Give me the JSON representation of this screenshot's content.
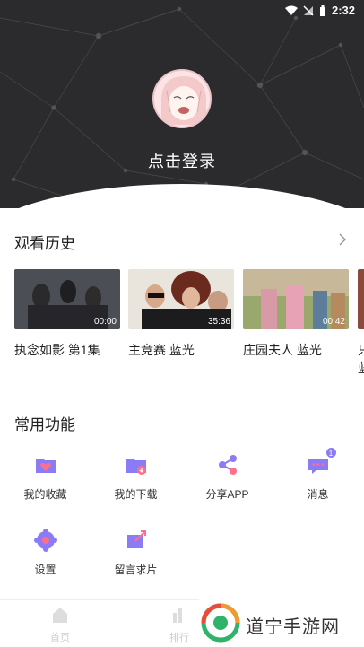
{
  "status_bar": {
    "time": "2:32"
  },
  "header": {
    "login_text": "点击登录"
  },
  "history": {
    "title": "观看历史",
    "items": [
      {
        "title": "执念如影 第1集",
        "duration": "00:00"
      },
      {
        "title": "主竞赛 蓝光",
        "duration": "35:36"
      },
      {
        "title": "庄园夫人 蓝光",
        "duration": "00:42"
      },
      {
        "title": "只 蓝",
        "duration": ""
      }
    ]
  },
  "functions": {
    "title": "常用功能",
    "items": [
      {
        "label": "我的收藏",
        "icon": "heart-folder-icon"
      },
      {
        "label": "我的下载",
        "icon": "download-folder-icon"
      },
      {
        "label": "分享APP",
        "icon": "share-icon"
      },
      {
        "label": "消息",
        "icon": "message-icon",
        "badge": "1"
      },
      {
        "label": "设置",
        "icon": "settings-icon"
      },
      {
        "label": "留言求片",
        "icon": "request-icon"
      }
    ]
  },
  "bottom_nav": [
    {
      "label": "首页",
      "icon": "home-icon"
    },
    {
      "label": "排行",
      "icon": "rank-icon"
    }
  ],
  "watermark": {
    "text": "道宁手游网"
  },
  "colors": {
    "accent": "#8b7cf6",
    "header_bg": "#2b2b2d"
  }
}
